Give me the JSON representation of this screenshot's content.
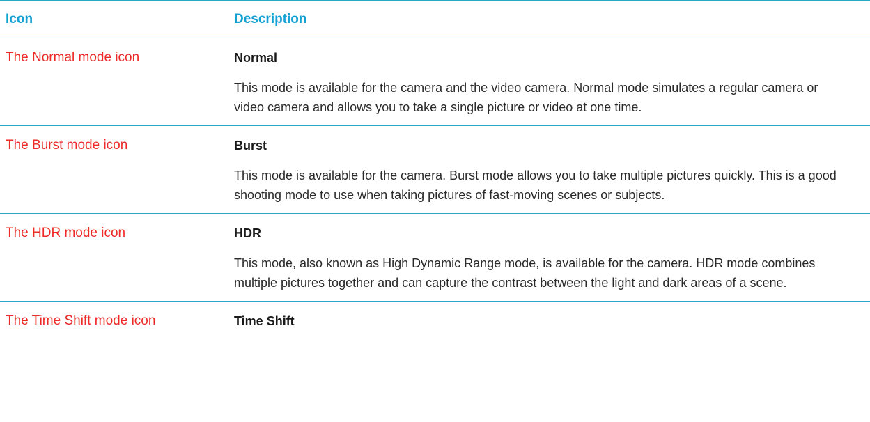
{
  "table": {
    "headers": {
      "icon": "Icon",
      "description": "Description"
    },
    "rows": [
      {
        "icon_alt": "The Normal mode icon",
        "icon": "normal-mode-icon",
        "name": "Normal",
        "description": "This mode is available for the camera and the video camera. Normal mode simulates a regular camera or video camera and allows you to take a single picture or video at one time."
      },
      {
        "icon_alt": "The Burst mode icon",
        "icon": "burst-mode-icon",
        "name": "Burst",
        "description": "This mode is available for the camera. Burst mode allows you to take multiple pictures quickly. This is a good shooting mode to use when taking pictures of fast-moving scenes or subjects."
      },
      {
        "icon_alt": "The HDR mode icon",
        "icon": "hdr-mode-icon",
        "name": "HDR",
        "description": "This mode, also known as High Dynamic Range mode, is available for the camera. HDR mode combines multiple pictures together and can capture the contrast between the light and dark areas of a scene."
      },
      {
        "icon_alt": "The Time Shift mode icon",
        "icon": "time-shift-mode-icon",
        "name": "Time Shift"
      }
    ]
  },
  "colors": {
    "header_text": "#14a1d3",
    "rule": "#2aa6c9",
    "broken_image_alt_text": "#ee2a27",
    "body_text": "#1a1a1a"
  }
}
